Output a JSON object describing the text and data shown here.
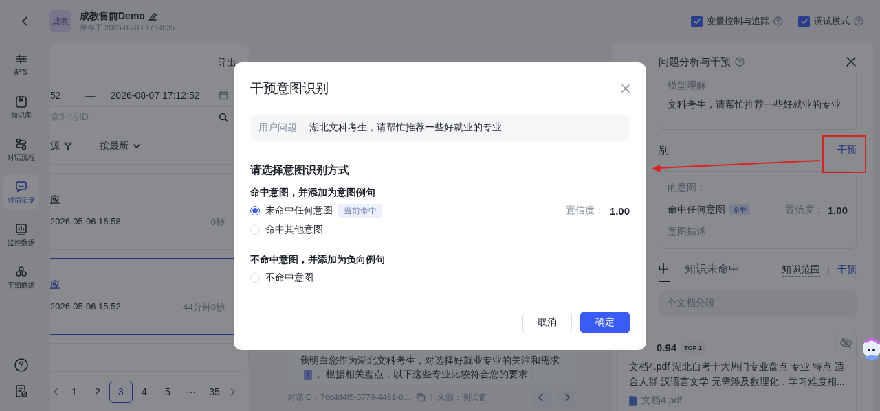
{
  "header": {
    "avatar": "成教",
    "title": "成教售前Demo",
    "saved": "保存于 2026-06-03 17:08:35",
    "toggles": [
      {
        "label": "变量控制与追踪",
        "checked": true
      },
      {
        "label": "调试模式",
        "checked": true
      }
    ]
  },
  "nav": {
    "items": [
      {
        "label": "配置",
        "selected": false
      },
      {
        "label": "知识库",
        "selected": false
      },
      {
        "label": "对话流程",
        "selected": false
      },
      {
        "label": "对话记录",
        "selected": true
      },
      {
        "label": "监控数据",
        "selected": false
      },
      {
        "label": "干预数据",
        "selected": false
      }
    ]
  },
  "records_panel": {
    "export": "导出",
    "date_start": "52",
    "date_separator": "—",
    "date_end": "2026-08-07 17:12:52",
    "search_placeholder": "索对话ID",
    "filter": "源",
    "sort": "按最新",
    "records": [
      {
        "title": "应",
        "time": "2026-05-06 16:58",
        "duration": "0秒",
        "selected": false
      },
      {
        "title": "应",
        "time": "2026-05-06 15:52",
        "duration": "44分钟8秒",
        "selected": true
      }
    ],
    "pages": [
      {
        "label": "1",
        "selected": false
      },
      {
        "label": "2",
        "selected": false
      },
      {
        "label": "3",
        "selected": true
      },
      {
        "label": "4",
        "selected": false
      },
      {
        "label": "5",
        "selected": false
      },
      {
        "label": "···",
        "selected": false
      },
      {
        "label": "35",
        "selected": false
      }
    ]
  },
  "chat": {
    "message_before": "我明白您作为湖北文科考生，对选择好就业专业的关注和需求",
    "citation": "1",
    "message_after": "。根据相关盘点，以下这些专业比较符合您的要求：",
    "conversation_id": "对话ID：7cc4d4f5-3779-4461-8...",
    "source": "来源：测试窗"
  },
  "analysis_panel": {
    "title": "问题分析与干预",
    "understanding_label": "模型理解",
    "understanding": "文科考生，请帮忙推荐一些好就业的专业",
    "intent_heading": "别",
    "intervene": "干预",
    "intent_label": "的意图：",
    "intent": "命中任何意图",
    "intent_badge": "命中",
    "confidence_label": "置信度：",
    "confidence": "1.00",
    "intent_description": "意图描述",
    "tabs": [
      {
        "label": "中",
        "selected": true
      },
      {
        "label": "知识未命中",
        "selected": false
      }
    ],
    "scope": "知识范围",
    "knowledge_intervene": "干预",
    "summary": "个文档分段",
    "hit": {
      "confidence": "0.94",
      "rank": "TOP 1",
      "text": "文档4.pdf 湖北自考十大热门专业盘点 专业 特点 适合人群 汉语言文学 无需涉及数理化，学习难度相...",
      "file": "文档4.pdf"
    }
  },
  "dialog": {
    "title": "干预意图识别",
    "question_label": "用户问题：",
    "question": "湖北文科考生，请帮忙推荐一些好就业的专业",
    "section_title": "请选择意图识别方式",
    "groups": [
      {
        "title": "命中意图，并添加为意图例句",
        "options": [
          {
            "label": "未命中任何意图",
            "selected": true,
            "badge": "当前命中",
            "confidence_label": "置信度：",
            "confidence": "1.00"
          },
          {
            "label": "命中其他意图",
            "selected": false
          }
        ]
      },
      {
        "title": "不命中意图，并添加为负向例句",
        "options": [
          {
            "label": "不命中意图",
            "selected": false
          }
        ]
      }
    ],
    "cancel": "取消",
    "confirm": "确定"
  }
}
